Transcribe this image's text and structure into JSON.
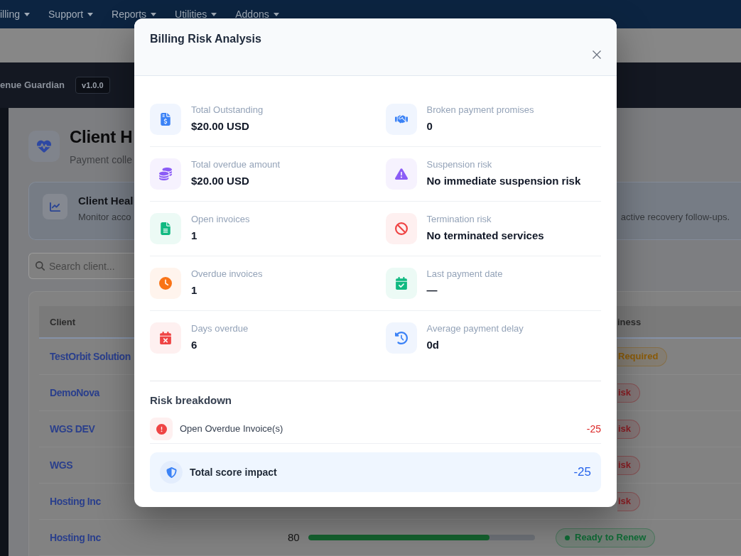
{
  "top_nav": {
    "items": [
      {
        "label": "illing"
      },
      {
        "label": "Support"
      },
      {
        "label": "Reports"
      },
      {
        "label": "Utilities"
      },
      {
        "label": "Addons"
      }
    ]
  },
  "app_header": {
    "title": "enue Guardian",
    "version": "v1.0.0"
  },
  "page_header": {
    "title": "Client H",
    "subtitle": "Payment colle"
  },
  "info_card": {
    "title": "Client Heal",
    "text": [
      "Monitor acco",
      "active recovery follow-ups."
    ]
  },
  "search": {
    "placeholder": "Search client..."
  },
  "client_table": {
    "columns": [
      {
        "label": "Client"
      },
      {
        "label": "iness"
      }
    ],
    "rows": [
      {
        "client": "TestOrbit Solution",
        "readiness": {
          "label": "Required",
          "color": "#8a5a07",
          "dot": false
        }
      },
      {
        "client": "DemoNova",
        "readiness": {
          "label": "isk",
          "color": "#8b1c22",
          "dot": false
        }
      },
      {
        "client": "WGS DEV",
        "readiness": {
          "label": "isk",
          "color": "#8b1c22",
          "dot": false
        }
      },
      {
        "client": "WGS",
        "readiness": {
          "label": "isk",
          "color": "#8b1c22",
          "dot": false
        }
      },
      {
        "client": "Hosting Inc",
        "readiness": {
          "label": "isk",
          "color": "#8b1c22",
          "dot": false
        }
      },
      {
        "client": "Hosting Inc",
        "score": "80",
        "level": 0.8,
        "readiness": {
          "label": "Ready to Renew",
          "color": "#0f6a35",
          "dot": true
        }
      }
    ]
  },
  "modal": {
    "title": "Billing Risk Analysis",
    "metrics": [
      {
        "label": "Total Outstanding",
        "value": "$20.00 USD",
        "color": "#3b82f6"
      },
      {
        "label": "Broken payment promises",
        "value": "0",
        "color": "#3b82f6"
      },
      {
        "label": "Total overdue amount",
        "value": "$20.00 USD",
        "color": "#8b5cf6"
      },
      {
        "label": "Suspension risk",
        "value": "No immediate suspension risk",
        "color": "#8b5cf6"
      },
      {
        "label": "Open invoices",
        "value": "1",
        "color": "#10b981"
      },
      {
        "label": "Termination risk",
        "value": "No terminated services",
        "color": "#ef4444"
      },
      {
        "label": "Overdue invoices",
        "value": "1",
        "color": "#f97316"
      },
      {
        "label": "Last payment date",
        "value": "—",
        "color": "#10b981"
      },
      {
        "label": "Days overdue",
        "value": "6",
        "color": "#ef4444"
      },
      {
        "label": "Average payment delay",
        "value": "0d",
        "color": "#3b82f6"
      }
    ],
    "breakdown": {
      "title": "Risk breakdown",
      "items": [
        {
          "label": "Open Overdue Invoice(s)",
          "impact": "-25"
        }
      ]
    },
    "total": {
      "label": "Total score impact",
      "value": "-25"
    }
  }
}
